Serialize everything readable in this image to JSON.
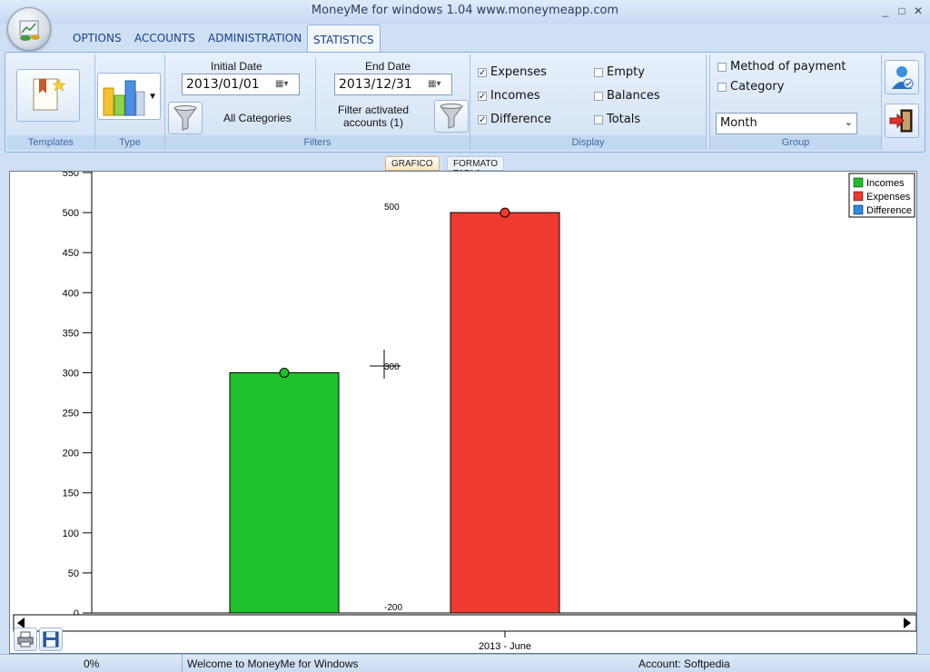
{
  "window": {
    "title": "MoneyMe for windows 1.04 www.moneymeapp.com",
    "controls": [
      "_",
      "□",
      "✕"
    ]
  },
  "tabs": [
    "OPTIONS",
    "ACCOUNTS",
    "ADMINISTRATION",
    "STATISTICS"
  ],
  "active_tab": "STATISTICS",
  "ribbon": {
    "groups": {
      "templates": "Templates",
      "type": "Type",
      "filters": "Filters",
      "display": "Display",
      "group": "Group"
    },
    "initial_date_label": "Initial Date",
    "initial_date": "2013/01/01",
    "end_date_label": "End Date",
    "end_date": "2013/12/31",
    "category_filter": "All Categories",
    "account_filter": "Filter activated accounts (1)",
    "display": {
      "expenses": {
        "label": "Expenses",
        "checked": true
      },
      "incomes": {
        "label": "Incomes",
        "checked": true
      },
      "difference": {
        "label": "Difference",
        "checked": true
      },
      "empty": {
        "label": "Empty",
        "checked": false
      },
      "balances": {
        "label": "Balances",
        "checked": false
      },
      "totals": {
        "label": "Totals",
        "checked": false
      }
    },
    "group_options": {
      "method_of_payment": {
        "label": "Method of payment",
        "checked": false
      },
      "category": {
        "label": "Category",
        "checked": false
      },
      "period": "Month"
    }
  },
  "view_tabs": [
    "GRAFICO",
    "FORMATO TABLA"
  ],
  "active_view_tab": "GRAFICO",
  "chart_data": {
    "type": "bar",
    "categories": [
      "2013 - June"
    ],
    "series": [
      {
        "name": "Incomes",
        "values": [
          300
        ],
        "color": "#1ec12a"
      },
      {
        "name": "Expenses",
        "values": [
          500
        ],
        "color": "#ee3a2f"
      },
      {
        "name": "Difference",
        "values": [
          -200
        ],
        "color": "#2c8de8"
      }
    ],
    "ylim": [
      0,
      550
    ],
    "yticks": [
      0,
      50,
      100,
      150,
      200,
      250,
      300,
      350,
      400,
      450,
      500,
      550
    ],
    "data_labels": [
      "500",
      "300",
      "-200"
    ],
    "legend_position": "top-right",
    "grid": false
  },
  "status": {
    "progress": "0%",
    "message": "Welcome to MoneyMe for Windows",
    "account": "Account: Softpedia"
  },
  "colors": {
    "ribbon_bg": "#d3e2f5",
    "accent": "#15428b",
    "income": "#1ec12a",
    "expense": "#ee3a2f",
    "difference": "#2c8de8"
  }
}
